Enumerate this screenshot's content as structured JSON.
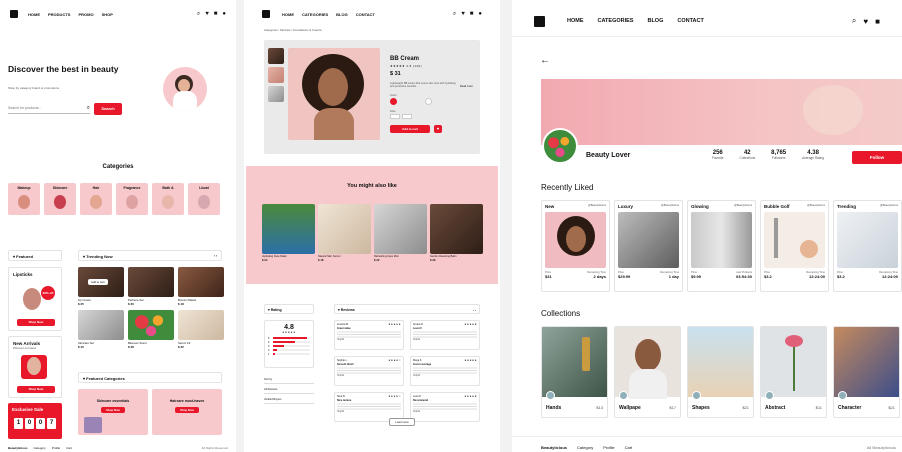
{
  "p1": {
    "nav": [
      "HOME",
      "PRODUCTS",
      "PROMO",
      "SHOP"
    ],
    "hero_title": "Discover the best in beauty",
    "hero_sub": "Shop by category brand or promotions",
    "search_placeholder": "Search for products...",
    "search_button": "Search",
    "categories_title": "Categories",
    "categories": [
      "Makeup",
      "Skincare",
      "Hair",
      "Fragrance",
      "Bath &",
      "Lboat"
    ],
    "featured_title": "Featured",
    "lipsticks": "Lipsticks",
    "lipsticks_badge": "30% off",
    "shop_now": "Shop Now",
    "new_arrivals": "New Arrivals",
    "new_arrivals_sub": "Discover our latest",
    "exclusive_sale": "Exclusive Sale",
    "countdown": [
      "1",
      "0",
      "0",
      "7"
    ],
    "trending_title": "Trending Now",
    "add_to_cart_chip": "Add to cart",
    "trending": [
      {
        "name": "Lip Cream",
        "price": "$ 25"
      },
      {
        "name": "Perfume Set",
        "price": "$ 30"
      },
      {
        "name": "Bronze Palette",
        "price": "$ 18"
      },
      {
        "name": "Skincare Set",
        "price": "$ 45"
      },
      {
        "name": "Blossom Scent",
        "price": "$ 28"
      },
      {
        "name": "Serum Kit",
        "price": "$ 32"
      }
    ],
    "featured_categories_title": "Featured Categories",
    "fc": [
      {
        "title": "Skincare essentials",
        "button": "Shop Now"
      },
      {
        "title": "Haircare must-haves",
        "button": "Shop Now"
      }
    ],
    "footer": [
      "Beautylicious",
      "Category",
      "Profile",
      "Cart"
    ],
    "footer_right": "All Rights Reserved"
  },
  "p2": {
    "nav": [
      "HOME",
      "CATEGORIES",
      "BLOG",
      "CONTACT"
    ],
    "breadcrumb": "Categories / Skincare / Foundations & Creams",
    "product_name": "BB Cream",
    "price": "$ 31",
    "rating_count": "★★★★★ 4.8 (120)",
    "desc": "Lightweight BB cream that evens skin tone with hydrating and protective benefits.",
    "read_more": "Read more",
    "color_label": "Color",
    "size_label": "Size",
    "add_to_cart": "Add to cart",
    "also_like_title": "You might also like",
    "also_like": [
      {
        "name": "Hydrating Face Mask",
        "price": "$ 24"
      },
      {
        "name": "Natural Skin Serum",
        "price": "$ 18"
      },
      {
        "name": "Refreshing Face Mist",
        "price": "$ 22"
      },
      {
        "name": "Gentle Cleansing Balm",
        "price": "$ 29"
      }
    ],
    "rating_title": "Rating",
    "rating_value": "4.8",
    "rating_bars": [
      0.92,
      0.6,
      0.3,
      0.1,
      0.05
    ],
    "rating_rows": [
      "5",
      "4",
      "3",
      "2",
      "1"
    ],
    "rating_filters": [
      "Sort by",
      "All Reviews",
      "Verified Buyers"
    ],
    "reviews_title": "Reviews",
    "reviews": [
      {
        "user": "Jessica M.",
        "title": "Great value",
        "stars": "★★★★★"
      },
      {
        "user": "Amara O.",
        "title": "Love it!",
        "stars": "★★★★★"
      },
      {
        "user": "Sophie L.",
        "title": "Smooth finish",
        "stars": "★★★★☆"
      },
      {
        "user": "Maya K.",
        "title": "Good coverage",
        "stars": "★★★★★"
      },
      {
        "user": "Nina R.",
        "title": "Nice texture",
        "stars": "★★★★☆"
      },
      {
        "user": "Lena P.",
        "title": "Recommend",
        "stars": "★★★★★"
      }
    ],
    "review_helpful": "Helpful",
    "load_more": "Load more"
  },
  "p3": {
    "nav": [
      "HOME",
      "CATEGORIES",
      "BLOG",
      "CONTACT"
    ],
    "profile_name": "Beauty Lover",
    "stats": [
      {
        "value": "256",
        "label": "Favorite"
      },
      {
        "value": "42",
        "label": "Collections"
      },
      {
        "value": "8,765",
        "label": "Followers"
      },
      {
        "value": "4.38",
        "label": "Average Rating"
      }
    ],
    "follow": "Follow",
    "recently_liked_title": "Recently Liked",
    "liked": [
      {
        "tag": "New",
        "handle": "@Beautylicious",
        "price_label": "Price",
        "price": "$31",
        "time_label": "Remaining Time",
        "time": "2 days"
      },
      {
        "tag": "Luxury",
        "handle": "@Beautylicious",
        "price_label": "Price",
        "price": "$29.99",
        "time_label": "Remaining Time",
        "time": "1 day"
      },
      {
        "tag": "Glowing",
        "handle": "@Beautylicious",
        "price_label": "Price",
        "price": "$9.99",
        "time_label": "Last Products",
        "time": "03:54:30"
      },
      {
        "tag": "Bubble Golf",
        "handle": "@Beautylicious",
        "price_label": "Price",
        "price": "$3.2",
        "time_label": "Remaining Time",
        "time": "12:24:00"
      },
      {
        "tag": "Trending",
        "handle": "@Beautylicious",
        "price_label": "Price",
        "price": "$3.2",
        "time_label": "Remaining Time",
        "time": "12:24:00"
      }
    ],
    "collections_title": "Collections",
    "collections": [
      {
        "name": "Hands",
        "count": "$13"
      },
      {
        "name": "Wallpape",
        "count": "$17"
      },
      {
        "name": "Shapes",
        "count": "$21"
      },
      {
        "name": "Abstract",
        "count": "$11"
      },
      {
        "name": "Character",
        "count": "$21"
      }
    ],
    "footer": [
      "Beautylicious",
      "Category",
      "Profile",
      "Cart"
    ],
    "footer_right": "All Beautylicious"
  }
}
